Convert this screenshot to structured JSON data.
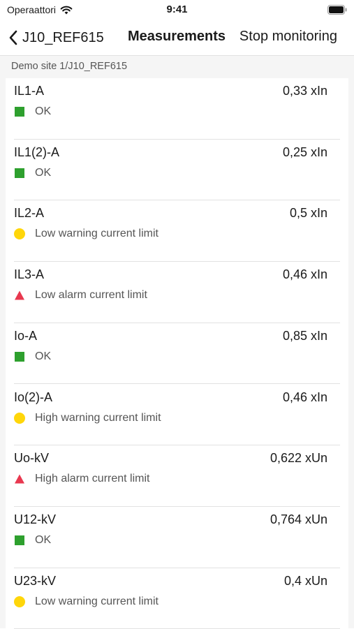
{
  "status_bar": {
    "carrier": "Operaattori",
    "time": "9:41"
  },
  "nav": {
    "back_label": "J10_REF615",
    "title": "Measurements",
    "action": "Stop monitoring"
  },
  "breadcrumb": "Demo site 1/J10_REF615",
  "colors": {
    "ok": "#2ea02e",
    "warning": "#ffd60a",
    "alarm": "#e8384f"
  },
  "measurements": [
    {
      "name": "IL1-A",
      "value": "0,33 xIn",
      "status": "ok",
      "status_text": "OK"
    },
    {
      "name": "IL1(2)-A",
      "value": "0,25 xIn",
      "status": "ok",
      "status_text": "OK"
    },
    {
      "name": "IL2-A",
      "value": "0,5 xIn",
      "status": "warning",
      "status_text": "Low warning current limit"
    },
    {
      "name": "IL3-A",
      "value": "0,46 xIn",
      "status": "alarm",
      "status_text": "Low alarm current limit"
    },
    {
      "name": "Io-A",
      "value": "0,85 xIn",
      "status": "ok",
      "status_text": "OK"
    },
    {
      "name": "Io(2)-A",
      "value": "0,46 xIn",
      "status": "warning",
      "status_text": "High warning current limit"
    },
    {
      "name": "Uo-kV",
      "value": "0,622 xUn",
      "status": "alarm",
      "status_text": "High alarm current limit"
    },
    {
      "name": "U12-kV",
      "value": "0,764 xUn",
      "status": "ok",
      "status_text": "OK"
    },
    {
      "name": "U23-kV",
      "value": "0,4 xUn",
      "status": "warning",
      "status_text": "Low warning current limit"
    }
  ]
}
